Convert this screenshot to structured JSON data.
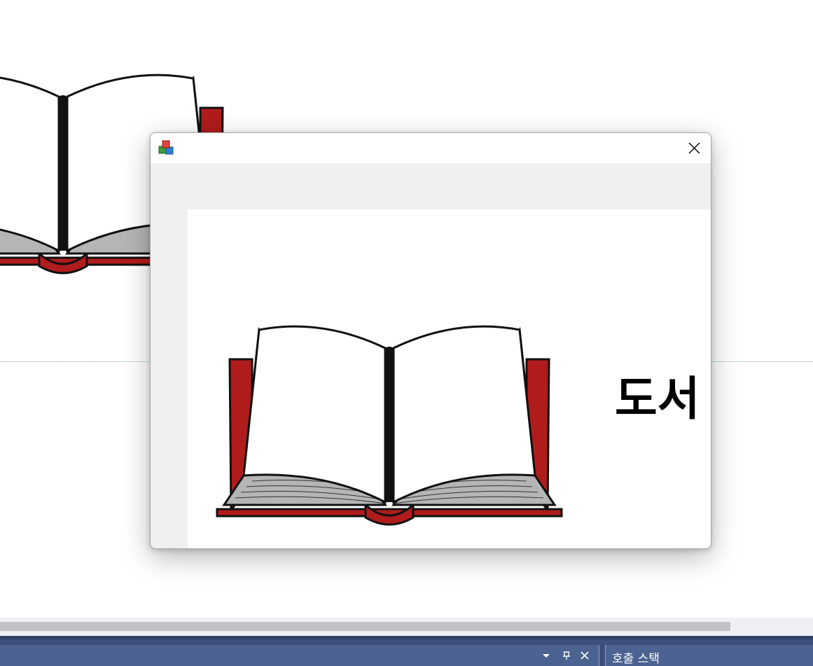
{
  "window": {
    "title": "",
    "close_icon": "close-icon",
    "app_icon": "colored-cubes-icon"
  },
  "form": {
    "heading": "도서",
    "image": "open-book-illustration"
  },
  "tool_panel": {
    "title": "호출 스택",
    "buttons": [
      "dropdown-arrow-icon",
      "pin-icon",
      "close-icon"
    ]
  },
  "colors": {
    "book_cover": "#b01c1c",
    "panel_bar": "#4c6391",
    "dialog_background": "#f0f0f0"
  }
}
